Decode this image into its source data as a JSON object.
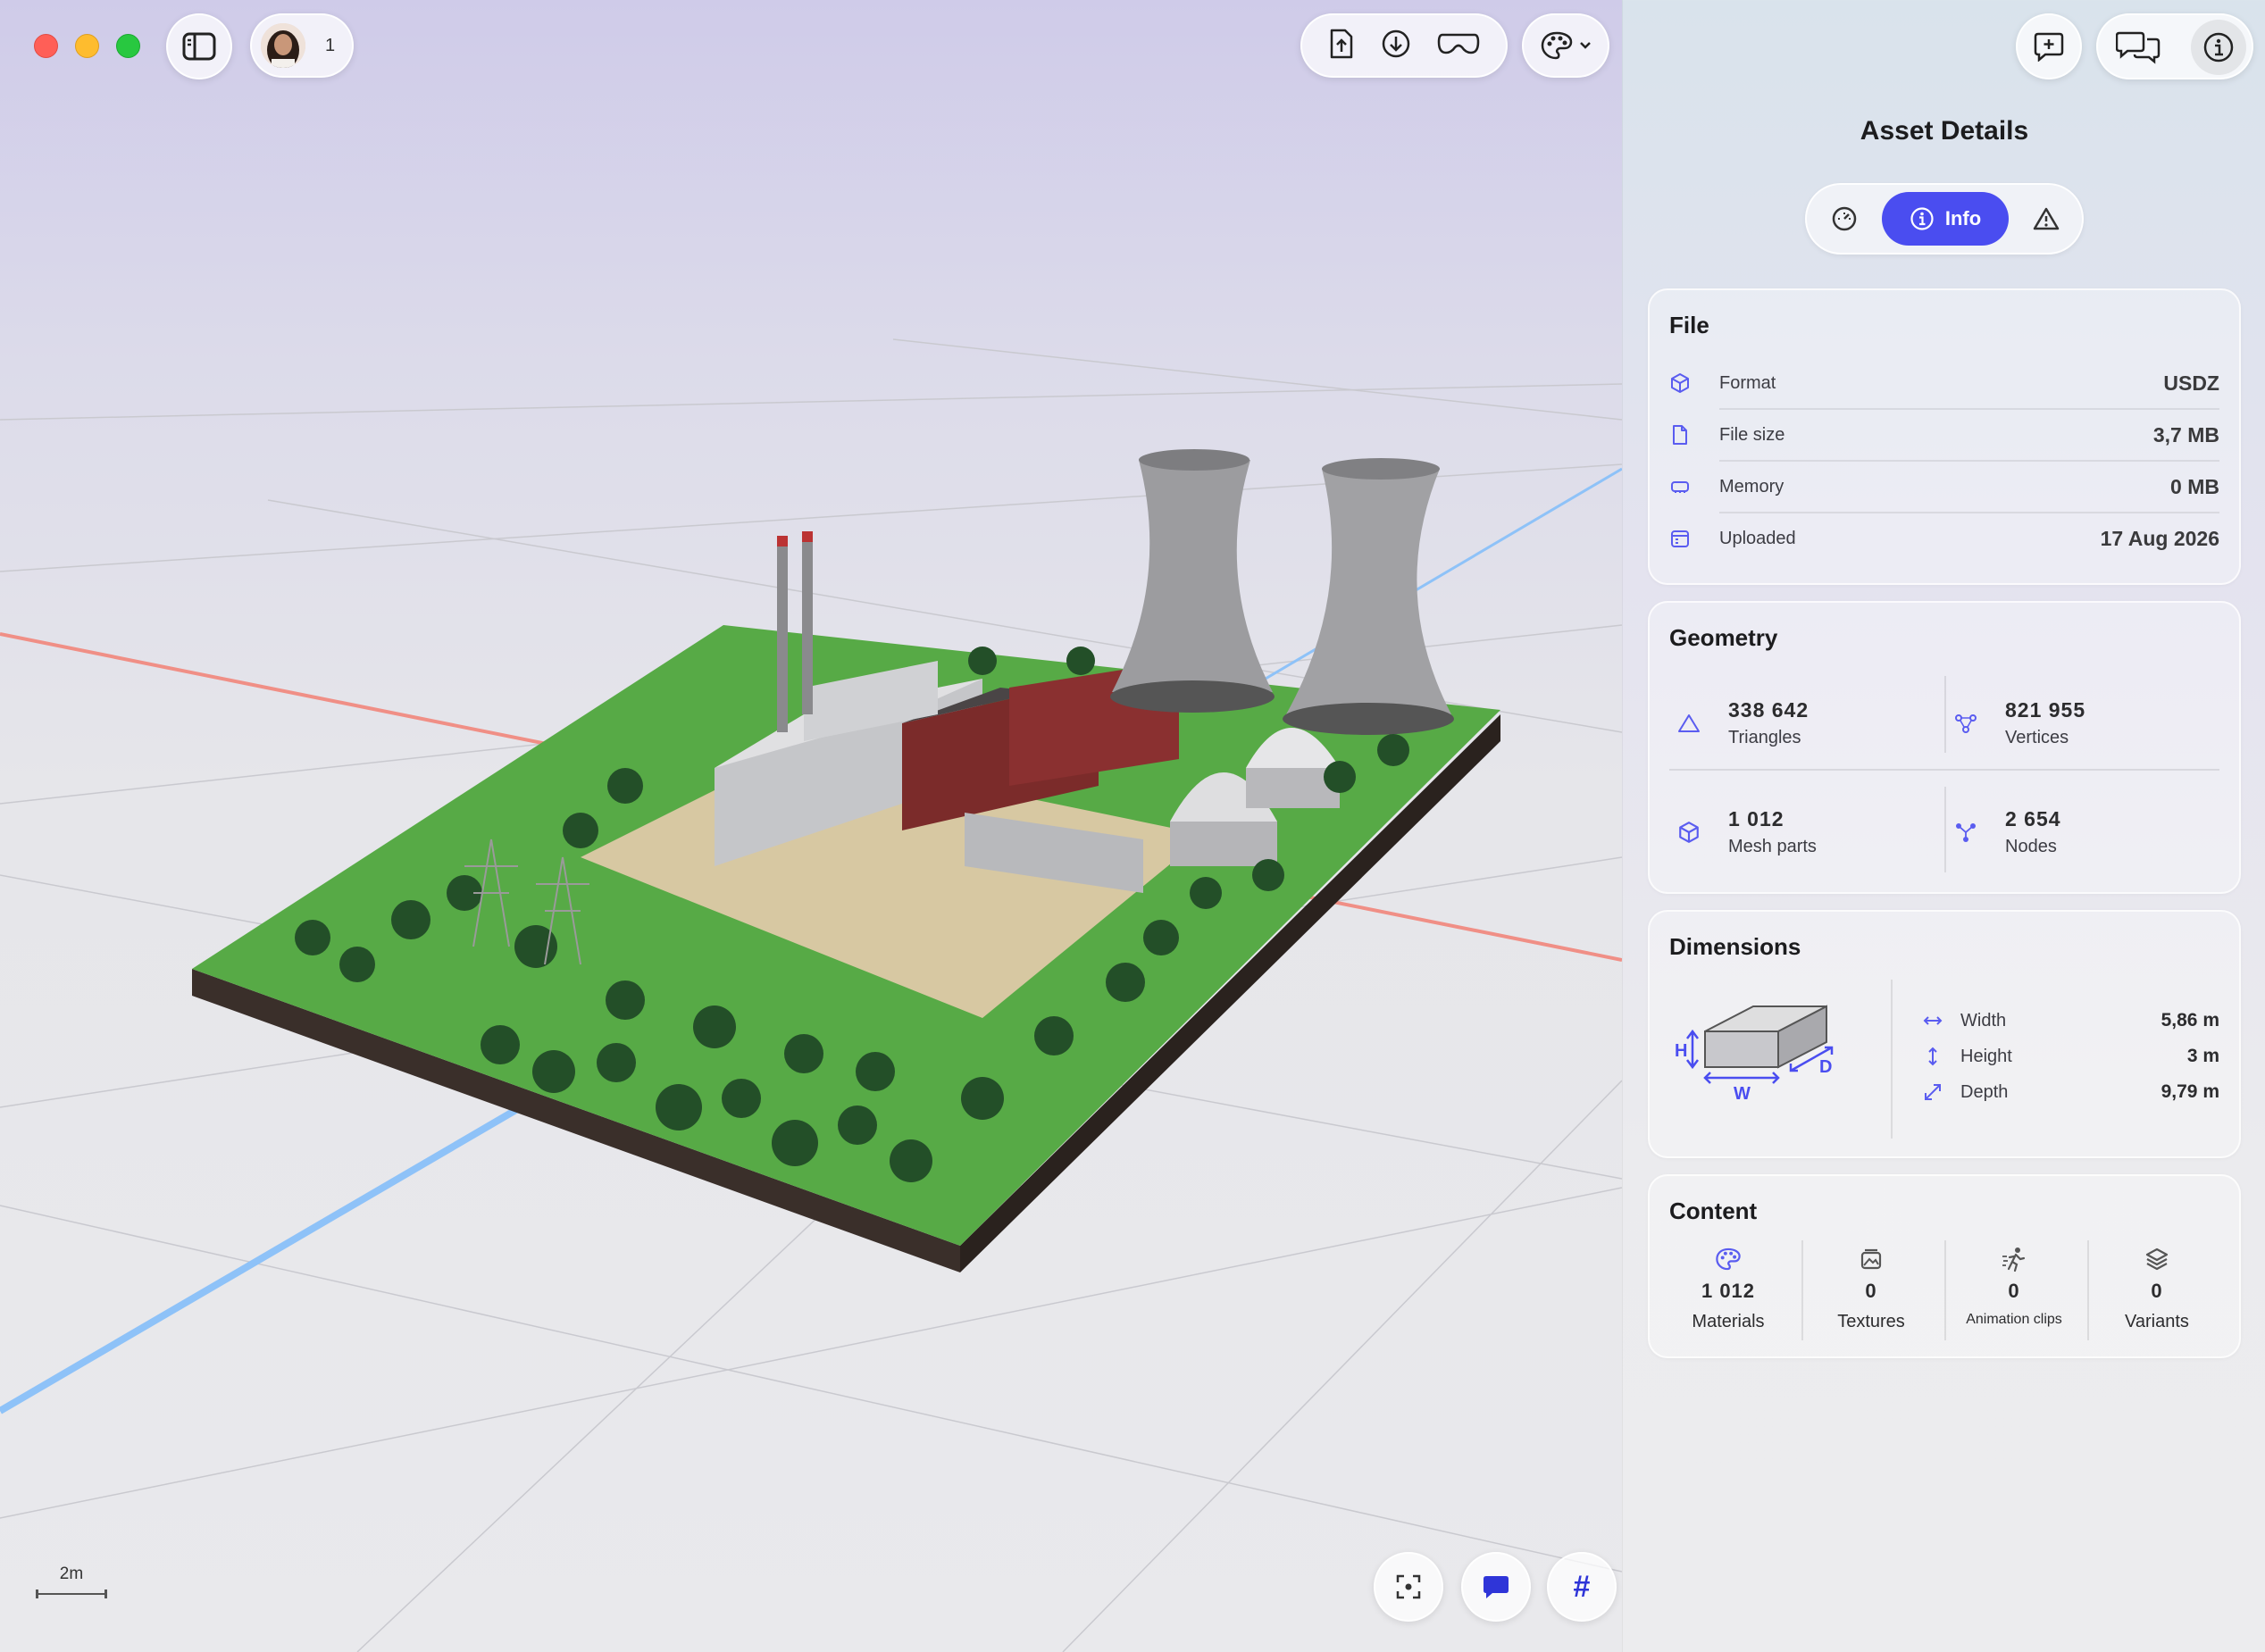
{
  "window": {
    "avatar_count": "1"
  },
  "viewport": {
    "scale_label": "2m"
  },
  "toolbar_icons": {
    "sidebar": "sidebar-toggle-icon",
    "export": "export-file-icon",
    "download": "download-icon",
    "headset": "vision-headset-icon",
    "palette": "palette-icon",
    "add_comment": "add-comment-icon",
    "comments": "comments-icon",
    "info": "info-icon"
  },
  "bottom_toolbar": {
    "hash_label": "#"
  },
  "colors": {
    "accent": "#4a4df0",
    "icon_accent": "#5a5cf0",
    "x_axis": "#f08f86",
    "z_axis": "#8ec2f8"
  },
  "panel": {
    "title": "Asset Details",
    "tabs": {
      "active": "Info"
    },
    "file": {
      "title": "File",
      "rows": [
        {
          "label": "Format",
          "value": "USDZ",
          "icon": "cube-icon"
        },
        {
          "label": "File size",
          "value": "3,7 MB",
          "icon": "document-icon"
        },
        {
          "label": "Memory",
          "value": "0 MB",
          "icon": "memory-icon"
        },
        {
          "label": "Uploaded",
          "value": "17 Aug 2026",
          "icon": "calendar-icon"
        }
      ]
    },
    "geometry": {
      "title": "Geometry",
      "cells": [
        {
          "value": "338 642",
          "label": "Triangles",
          "icon": "triangle-icon"
        },
        {
          "value": "821 955",
          "label": "Vertices",
          "icon": "vertices-icon"
        },
        {
          "value": "1 012",
          "label": "Mesh parts",
          "icon": "cube-icon"
        },
        {
          "value": "2 654",
          "label": "Nodes",
          "icon": "nodes-icon"
        }
      ]
    },
    "dimensions": {
      "title": "Dimensions",
      "diagram": {
        "h": "H",
        "w": "W",
        "d": "D"
      },
      "rows": [
        {
          "label": "Width",
          "value": "5,86 m",
          "icon": "width-arrow-icon"
        },
        {
          "label": "Height",
          "value": "3 m",
          "icon": "height-arrow-icon"
        },
        {
          "label": "Depth",
          "value": "9,79 m",
          "icon": "depth-arrow-icon"
        }
      ]
    },
    "content": {
      "title": "Content",
      "cells": [
        {
          "value": "1 012",
          "label": "Materials",
          "icon": "palette-icon"
        },
        {
          "value": "0",
          "label": "Textures",
          "icon": "texture-icon"
        },
        {
          "value": "0",
          "label": "Animation clips",
          "icon": "animation-icon"
        },
        {
          "value": "0",
          "label": "Variants",
          "icon": "layers-icon"
        }
      ]
    }
  }
}
